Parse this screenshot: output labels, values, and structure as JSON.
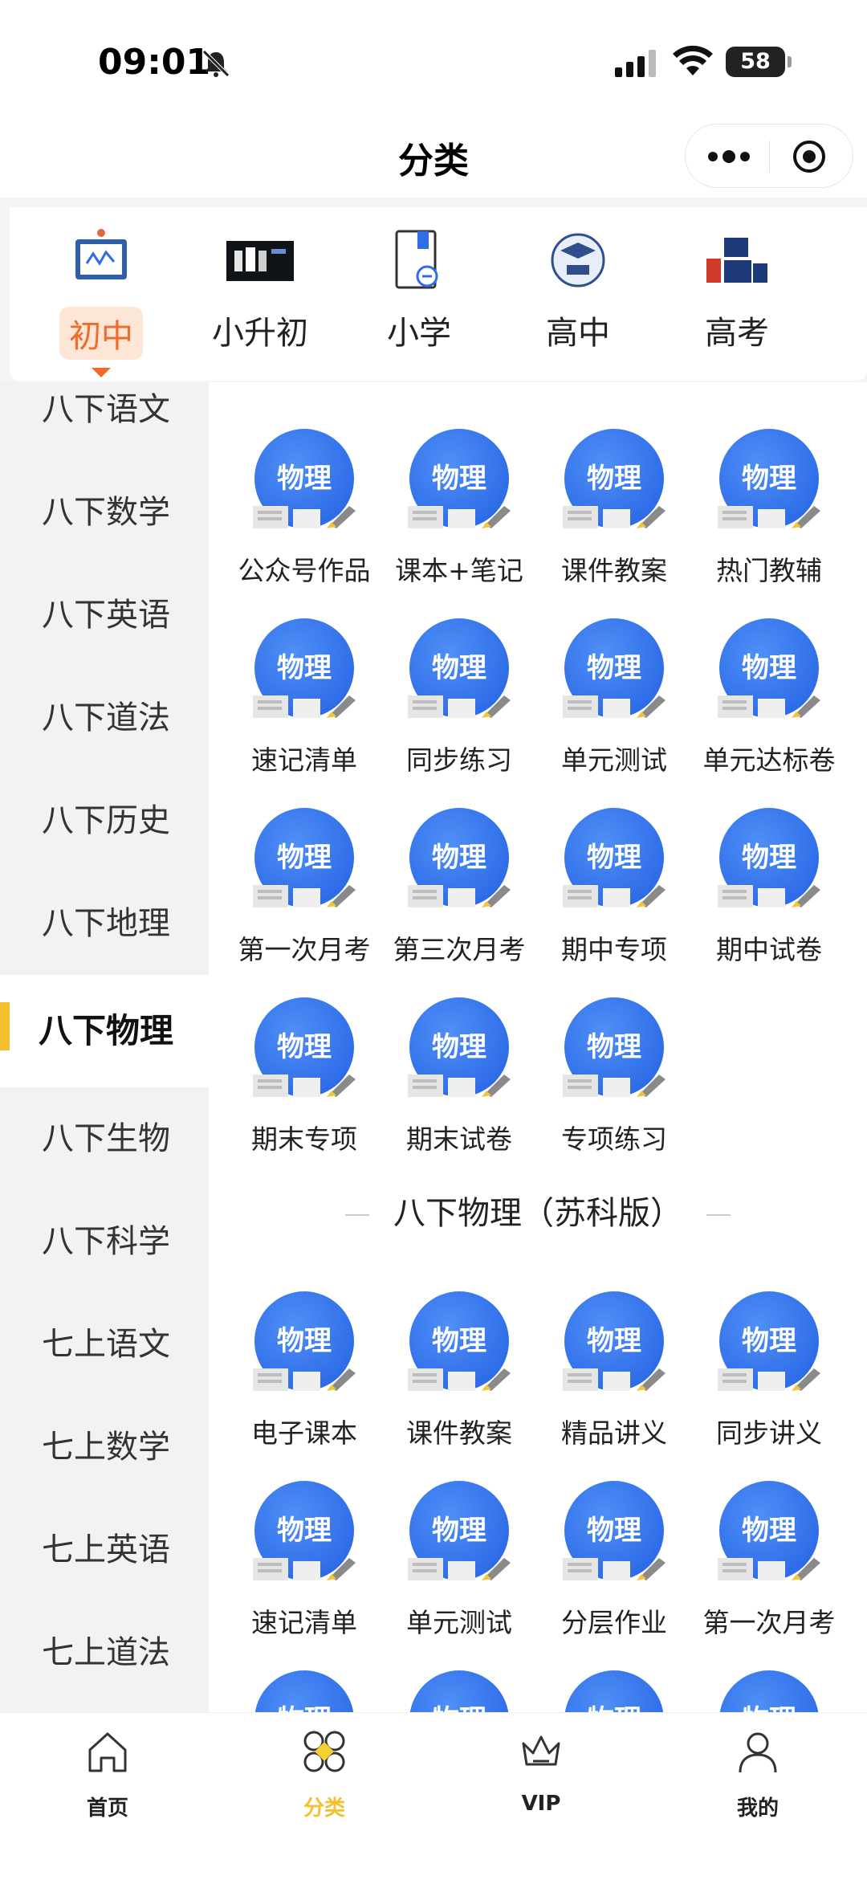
{
  "status_bar": {
    "time": "09:01",
    "battery": "58"
  },
  "nav": {
    "title": "分类"
  },
  "category_tabs": [
    {
      "label": "初中",
      "active": true
    },
    {
      "label": "小升初",
      "active": false
    },
    {
      "label": "小学",
      "active": false
    },
    {
      "label": "高中",
      "active": false
    },
    {
      "label": "高考",
      "active": false
    }
  ],
  "sidebar": {
    "items": [
      {
        "label": "八下语文"
      },
      {
        "label": "八下数学"
      },
      {
        "label": "八下英语"
      },
      {
        "label": "八下道法"
      },
      {
        "label": "八下历史"
      },
      {
        "label": "八下地理"
      },
      {
        "label": "八下物理",
        "active": true
      },
      {
        "label": "八下生物"
      },
      {
        "label": "八下科学"
      },
      {
        "label": "七上语文"
      },
      {
        "label": "七上数学"
      },
      {
        "label": "七上英语"
      },
      {
        "label": "七上道法"
      }
    ]
  },
  "content": {
    "badge_text": "物理",
    "section1": {
      "items": [
        {
          "label": "公众号作品"
        },
        {
          "label": "课本+笔记"
        },
        {
          "label": "课件教案"
        },
        {
          "label": "热门教辅"
        },
        {
          "label": "速记清单"
        },
        {
          "label": "同步练习"
        },
        {
          "label": "单元测试"
        },
        {
          "label": "单元达标卷"
        },
        {
          "label": "第一次月考"
        },
        {
          "label": "第三次月考"
        },
        {
          "label": "期中专项"
        },
        {
          "label": "期中试卷"
        },
        {
          "label": "期末专项"
        },
        {
          "label": "期末试卷"
        },
        {
          "label": "专项练习"
        }
      ]
    },
    "section2": {
      "title": "八下物理（苏科版）",
      "items": [
        {
          "label": "电子课本"
        },
        {
          "label": "课件教案"
        },
        {
          "label": "精品讲义"
        },
        {
          "label": "同步讲义"
        },
        {
          "label": "速记清单"
        },
        {
          "label": "单元测试"
        },
        {
          "label": "分层作业"
        },
        {
          "label": "第一次月考"
        }
      ]
    }
  },
  "tabbar": [
    {
      "label": "首页",
      "icon": "home-icon"
    },
    {
      "label": "分类",
      "icon": "category-icon",
      "active": true
    },
    {
      "label": "VIP",
      "icon": "crown-icon"
    },
    {
      "label": "我的",
      "icon": "user-icon"
    }
  ],
  "colors": {
    "accent_orange": "#ef6b2b",
    "accent_yellow": "#f4c030",
    "badge_blue": "#2f6ee8"
  }
}
